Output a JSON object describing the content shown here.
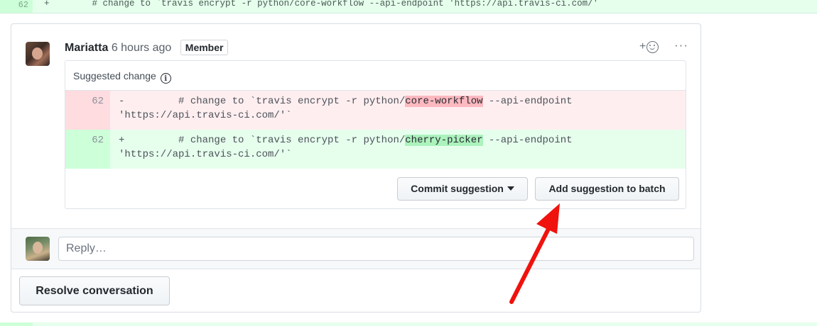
{
  "top_diff": {
    "line_number": "62",
    "sign": "+",
    "code": "# change to `travis encrypt -r python/core-workflow --api-endpoint 'https://api.travis-ci.com/'"
  },
  "comment": {
    "author": "Mariatta",
    "time": "6 hours ago",
    "badge": "Member",
    "reaction_plus": "+",
    "more_menu": "···"
  },
  "suggestion": {
    "header": "Suggested change",
    "info_icon": "i",
    "deleted": {
      "line_number": "62",
      "sign": "-",
      "pre": "        # change to `travis encrypt -r python/",
      "highlight": "core-workflow",
      "post": " --api-endpoint",
      "continuation": "'https://api.travis-ci.com/'`"
    },
    "added": {
      "line_number": "62",
      "sign": "+",
      "pre": "        # change to `travis encrypt -r python/",
      "highlight": "cherry-picker",
      "post": " --api-endpoint",
      "continuation": "'https://api.travis-ci.com/'`"
    },
    "commit_button": "Commit suggestion",
    "batch_button": "Add suggestion to batch"
  },
  "reply": {
    "placeholder": "Reply…"
  },
  "resolve_button": "Resolve conversation",
  "colors": {
    "annotation_arrow": "#f0120d",
    "deleted_highlight": "#fdb8c0",
    "added_highlight": "#acf2bd"
  }
}
